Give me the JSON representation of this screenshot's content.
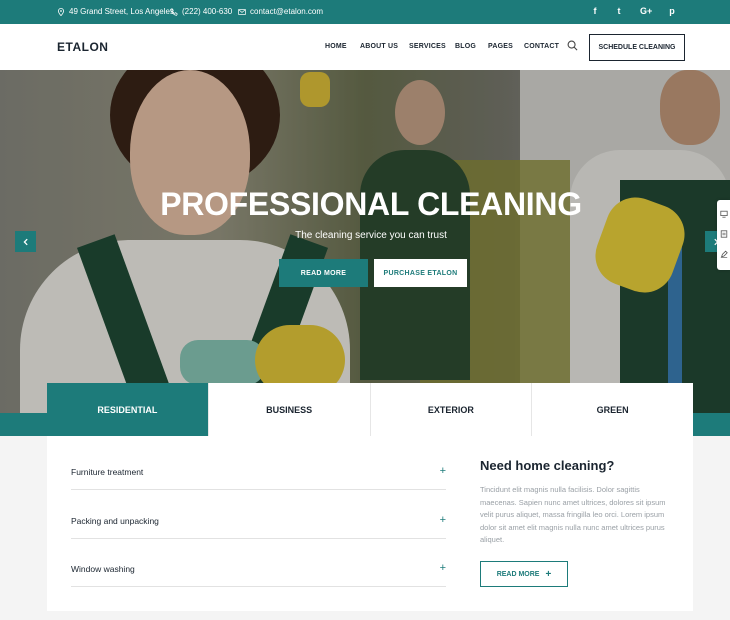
{
  "topbar": {
    "address": "49 Grand Street, Los Angeles",
    "phone": "(222) 400-630",
    "email": "contact@etalon.com",
    "social": [
      "f",
      "t",
      "G+",
      "p"
    ],
    "social_icons": [
      "facebook-icon",
      "twitter-icon",
      "google-plus-icon",
      "pinterest-icon"
    ]
  },
  "header": {
    "logo": "ETALON",
    "nav": [
      "HOME",
      "ABOUT US",
      "SERVICES",
      "BLOG",
      "PAGES",
      "CONTACT"
    ],
    "cta": "SCHEDULE CLEANING"
  },
  "hero": {
    "title": "PROFESSIONAL CLEANING",
    "subtitle": "The cleaning service you can trust",
    "primary_button": "READ MORE",
    "secondary_button": "PURCHASE ETALON"
  },
  "tabs": {
    "items": [
      "RESIDENTIAL",
      "BUSINESS",
      "EXTERIOR",
      "GREEN"
    ],
    "active": "RESIDENTIAL"
  },
  "accordion": {
    "items": [
      "Furniture treatment",
      "Packing and unpacking",
      "Window washing"
    ],
    "toggle": "+"
  },
  "info": {
    "title": "Need home cleaning?",
    "text": "Tincidunt elit magnis nulla facilisis. Dolor sagittis maecenas. Sapien nunc amet ultrices, dolores sit ipsum velit purus aliquet, massa fringilla leo orci. Lorem ipsum dolor sit amet elit magnis nulla nunc amet ultrices purus aliquet.",
    "button": "READ MORE",
    "button_icon": "+"
  },
  "colors": {
    "accent": "#1d7b7a",
    "dark": "#1b2530",
    "muted": "#9aa0a6"
  }
}
